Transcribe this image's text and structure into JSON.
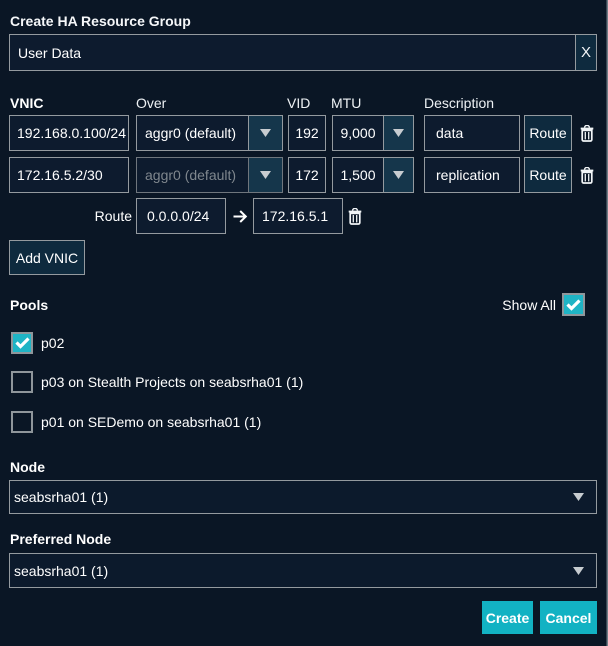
{
  "colors": {
    "background": "#0a1625",
    "input_background": "#0d1b2e",
    "border": "#949a9f",
    "button_background": "#0e2a3e",
    "accent_teal": "#12b2c3",
    "checkbox_teal": "#1fb4c5",
    "disabled_text": "#7f878e"
  },
  "dialog": {
    "title": "Create HA Resource Group",
    "name_field": {
      "value": "User Data",
      "clear_label": "X"
    },
    "vnic_table": {
      "headers": {
        "vnic": "VNIC",
        "over": "Over",
        "vid": "VID",
        "mtu": "MTU",
        "description": "Description"
      },
      "rows": [
        {
          "vnic": "192.168.0.100/24",
          "over": "aggr0 (default)",
          "vid": "192",
          "mtu": "9,000",
          "description": "data",
          "route_label": "Route"
        },
        {
          "vnic": "172.16.5.2/30",
          "over": "aggr0 (default)",
          "vid": "172",
          "mtu": "1,500",
          "description": "replication",
          "route_label": "Route"
        }
      ],
      "route_row": {
        "label": "Route",
        "destination": "0.0.0.0/24",
        "gateway": "172.16.5.1"
      }
    },
    "add_vnic_label": "Add VNIC",
    "pools": {
      "label": "Pools",
      "show_all_label": "Show All",
      "show_all_checked": true,
      "items": [
        {
          "label": "p02",
          "checked": true
        },
        {
          "label": "p03 on Stealth Projects on seabsrha01 (1)",
          "checked": false
        },
        {
          "label": "p01 on SEDemo on seabsrha01 (1)",
          "checked": false
        }
      ]
    },
    "node": {
      "label": "Node",
      "value": "seabsrha01 (1)"
    },
    "preferred_node": {
      "label": "Preferred Node",
      "value": "seabsrha01 (1)"
    },
    "footer": {
      "create_label": "Create",
      "cancel_label": "Cancel"
    }
  }
}
